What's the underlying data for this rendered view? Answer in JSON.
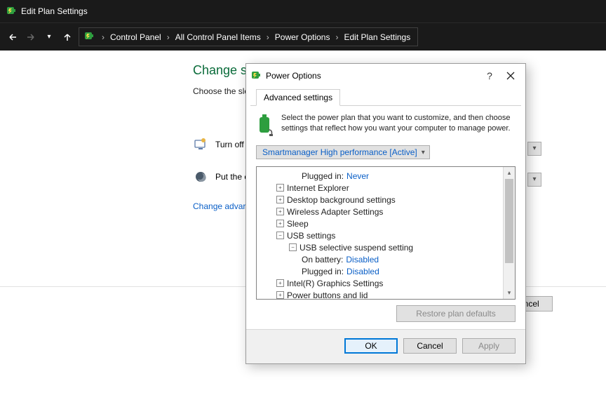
{
  "window": {
    "title": "Edit Plan Settings"
  },
  "breadcrumb": [
    "Control Panel",
    "All Control Panel Items",
    "Power Options",
    "Edit Plan Settings"
  ],
  "page": {
    "heading": "Change se",
    "description": "Choose the sle",
    "turn_off_label": "Turn off t",
    "put_computer_label": "Put the co",
    "change_advanced_link": "Change advar",
    "bg_cancel": "Cancel"
  },
  "dialog": {
    "title": "Power Options",
    "tab": "Advanced settings",
    "info": "Select the power plan that you want to customize, and then choose settings that reflect how you want your computer to manage power.",
    "plan_selected": "Smartmanager High performance [Active]",
    "plugged_in_top": {
      "label": "Plugged in:",
      "value": "Never"
    },
    "tree": {
      "ie": "Internet Explorer",
      "desktop": "Desktop background settings",
      "wireless": "Wireless Adapter Settings",
      "sleep": "Sleep",
      "usb": "USB settings",
      "usb_sel": "USB selective suspend setting",
      "on_battery": {
        "label": "On battery:",
        "value": "Disabled"
      },
      "plugged_in": {
        "label": "Plugged in:",
        "value": "Disabled"
      },
      "intel": "Intel(R) Graphics Settings",
      "power_buttons": "Power buttons and lid"
    },
    "restore": "Restore plan defaults",
    "ok": "OK",
    "cancel": "Cancel",
    "apply": "Apply"
  }
}
